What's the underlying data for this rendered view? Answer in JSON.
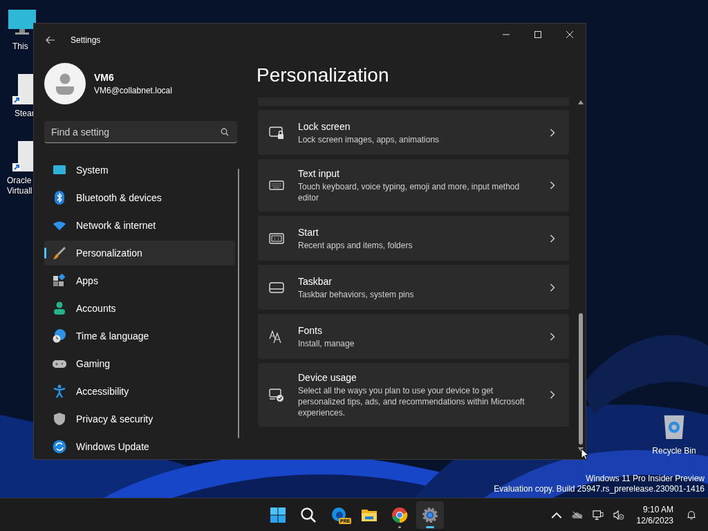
{
  "desktop": {
    "icons": [
      {
        "kind": "monitor",
        "lines": [
          "This"
        ]
      },
      {
        "kind": "shortcut",
        "lines": [
          "Stear"
        ]
      },
      {
        "kind": "shortcut",
        "lines": [
          "Oracle",
          "Virtuall"
        ]
      }
    ],
    "recycle_bin": {
      "label": "Recycle Bin"
    },
    "watermark": [
      "Windows 11 Pro Insider Preview",
      "Evaluation copy. Build 25947.rs_prerelease.230901-1416"
    ]
  },
  "window": {
    "title": "Settings",
    "user": {
      "name": "VM6",
      "email": "VM6@collabnet.local"
    },
    "search": {
      "placeholder": "Find a setting"
    },
    "nav": [
      {
        "label": "System",
        "kind": "system",
        "selected": false
      },
      {
        "label": "Bluetooth & devices",
        "kind": "bluetooth",
        "selected": false
      },
      {
        "label": "Network & internet",
        "kind": "network",
        "selected": false
      },
      {
        "label": "Personalization",
        "kind": "brush",
        "selected": true
      },
      {
        "label": "Apps",
        "kind": "apps",
        "selected": false
      },
      {
        "label": "Accounts",
        "kind": "accounts",
        "selected": false
      },
      {
        "label": "Time & language",
        "kind": "time",
        "selected": false
      },
      {
        "label": "Gaming",
        "kind": "gaming",
        "selected": false
      },
      {
        "label": "Accessibility",
        "kind": "accessibility",
        "selected": false
      },
      {
        "label": "Privacy & security",
        "kind": "privacy",
        "selected": false
      },
      {
        "label": "Windows Update",
        "kind": "update",
        "selected": false
      }
    ],
    "page_title": "Personalization",
    "cards": [
      {
        "kind": "lock",
        "title": "Lock screen",
        "description": "Lock screen images, apps, animations"
      },
      {
        "kind": "keyboard",
        "title": "Text input",
        "description": "Touch keyboard, voice typing, emoji and more, input method editor"
      },
      {
        "kind": "start",
        "title": "Start",
        "description": "Recent apps and items, folders"
      },
      {
        "kind": "taskbar",
        "title": "Taskbar",
        "description": "Taskbar behaviors, system pins"
      },
      {
        "kind": "fonts",
        "title": "Fonts",
        "description": "Install, manage"
      },
      {
        "kind": "device",
        "title": "Device usage",
        "description": "Select all the ways you plan to use your device to get personalized tips, ads, and recommendations within Microsoft experiences."
      }
    ]
  },
  "taskbar": {
    "apps": [
      {
        "kind": "start",
        "selected": false,
        "running": false
      },
      {
        "kind": "search",
        "selected": false,
        "running": false
      },
      {
        "kind": "edge",
        "badge": "PRE",
        "selected": false,
        "running": false
      },
      {
        "kind": "explorer",
        "selected": false,
        "running": false
      },
      {
        "kind": "chrome",
        "selected": false,
        "running": true
      },
      {
        "kind": "settings",
        "selected": true,
        "running": true
      }
    ],
    "time": "9:10 AM",
    "date": "12/6/2023"
  }
}
